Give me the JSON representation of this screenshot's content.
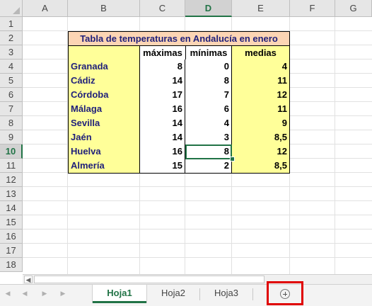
{
  "columns": [
    "A",
    "B",
    "C",
    "D",
    "E",
    "F",
    "G"
  ],
  "selected_column": "D",
  "rows": [
    "1",
    "2",
    "3",
    "4",
    "5",
    "6",
    "7",
    "8",
    "9",
    "10",
    "11",
    "12",
    "13",
    "14",
    "15",
    "16",
    "17",
    "18"
  ],
  "selected_row": "10",
  "table": {
    "title": "Tabla de temperaturas en Andalucía en enero",
    "headers": [
      "máximas",
      "mínimas",
      "medias"
    ],
    "rows": [
      {
        "city": "Granada",
        "max": "8",
        "min": "0",
        "avg": "4"
      },
      {
        "city": "Cádiz",
        "max": "14",
        "min": "8",
        "avg": "11"
      },
      {
        "city": "Córdoba",
        "max": "17",
        "min": "7",
        "avg": "12"
      },
      {
        "city": "Málaga",
        "max": "16",
        "min": "6",
        "avg": "11"
      },
      {
        "city": "Sevilla",
        "max": "14",
        "min": "4",
        "avg": "9"
      },
      {
        "city": "Jaén",
        "max": "14",
        "min": "3",
        "avg": "8,5"
      },
      {
        "city": "Huelva",
        "max": "16",
        "min": "8",
        "avg": "12"
      },
      {
        "city": "Almería",
        "max": "15",
        "min": "2",
        "avg": "8,5"
      }
    ]
  },
  "active_cell": "D10",
  "sheet_tabs": [
    {
      "label": "Hoja1",
      "active": true
    },
    {
      "label": "Hoja2",
      "active": false
    },
    {
      "label": "Hoja3",
      "active": false
    }
  ],
  "icons": {
    "add_sheet": "plus-circle-icon",
    "nav_first": "nav-first-icon",
    "nav_prev": "nav-prev-icon",
    "nav_next": "nav-next-icon",
    "nav_last": "nav-last-icon",
    "scroll_left": "scroll-left-icon"
  },
  "colors": {
    "accent": "#217346",
    "title_fill": "#fcd5b4",
    "city_fill": "#ffff99",
    "highlight_box": "#e00000"
  }
}
